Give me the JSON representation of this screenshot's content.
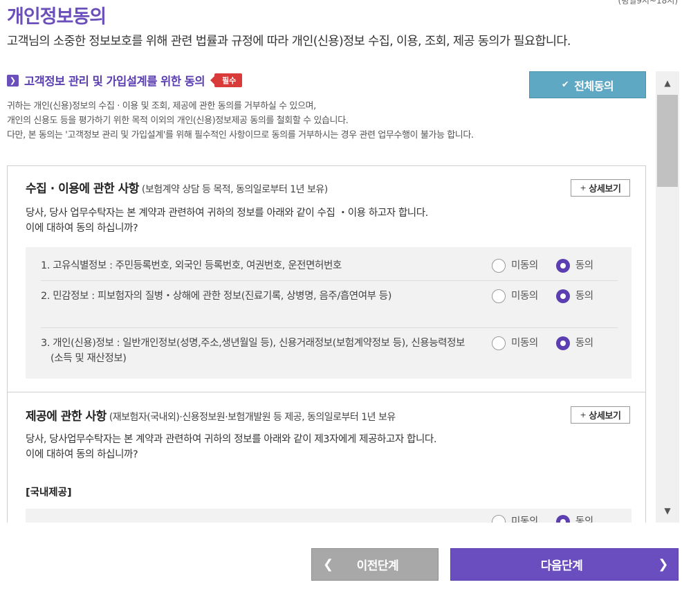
{
  "page": {
    "title": "개인정보동의",
    "top_note": "(평일9시~18시)",
    "subtitle": "고객님의 소중한 정보보호를 위해 관련 법률과 규정에 따라 개인(신용)정보 수집, 이용, 조회, 제공 동의가 필요합니다."
  },
  "section": {
    "icon": "chevron-right-icon",
    "title": "고객정보 관리 및 가입설계를 위한 동의",
    "required_badge": "필수",
    "all_agree_label": "전체동의",
    "notice_lines": [
      "귀하는 개인(신용)정보의 수집 · 이용 및 조회, 제공에 관한 동의를 거부하실 수 있으며,",
      "개인의 신용도 등을 평가하기 위한 목적 이외의 개인(신용)정보제공 동의를 철회할 수 있습니다.",
      "다만, 본 동의는 '고객정보 관리 및 가입설계'를 위해 필수적인 사항이므로 동의를 거부하시는 경우 관련 업무수행이 불가능 합니다."
    ]
  },
  "collection": {
    "title": "수집 · 이용에 관한 사항",
    "subtitle": "(보험계약 상담 등 목적, 동의일로부터 1년 보유)",
    "detail_label": "상세보기",
    "desc_lines": [
      "당사, 당사 업무수탁자는 본 계약과 관련하여 귀하의 정보를 아래와 같이 수집 ・이용 하고자 합니다.",
      "이에 대하여 동의 하십니까?"
    ],
    "items": [
      {
        "text": "1. 고유식별정보 : 주민등록번호, 외국인 등록번호, 여권번호, 운전면허번호",
        "disagree": "미동의",
        "agree": "동의",
        "selected": "agree"
      },
      {
        "text": "2. 민감정보 : 피보험자의 질병・상해에 관한 정보(진료기록, 상병명, 음주/흡연여부 등)",
        "disagree": "미동의",
        "agree": "동의",
        "selected": "agree"
      },
      {
        "text": "3. 개인(신용)정보 : 일반개인정보(성명,주소,생년월일 등), 신용거래정보(보험계약정보 등), 신용능력정보(소득 및 재산정보)",
        "disagree": "미동의",
        "agree": "동의",
        "selected": "agree"
      }
    ]
  },
  "provision": {
    "title": "제공에 관한 사항",
    "subtitle": "(재보험자(국내외)·신용정보원·보험개발원 등 제공, 동의일로부터 1년 보유",
    "detail_label": "상세보기",
    "desc_lines": [
      "당사, 당사업무수탁자는 본 계약과 관련하여 귀하의 정보를 아래와 같이 제3자에게 제공하고자 합니다.",
      "이에 대하여 동의 하십니까?"
    ],
    "domestic_label": "[국내제공]",
    "first_item": {
      "disagree": "미동의",
      "agree": "동의",
      "selected": "agree"
    }
  },
  "scrollbar": {
    "up_icon": "arrow-up-icon",
    "down_icon": "arrow-down-icon"
  },
  "footer": {
    "prev_label": "이전단계",
    "next_label": "다음단계"
  },
  "colors": {
    "brand": "#6b4fbb",
    "all_agree": "#5fa8c3",
    "required": "#d93a3a",
    "prev_button": "#a8a8a8",
    "next_button": "#6a4ec0"
  }
}
